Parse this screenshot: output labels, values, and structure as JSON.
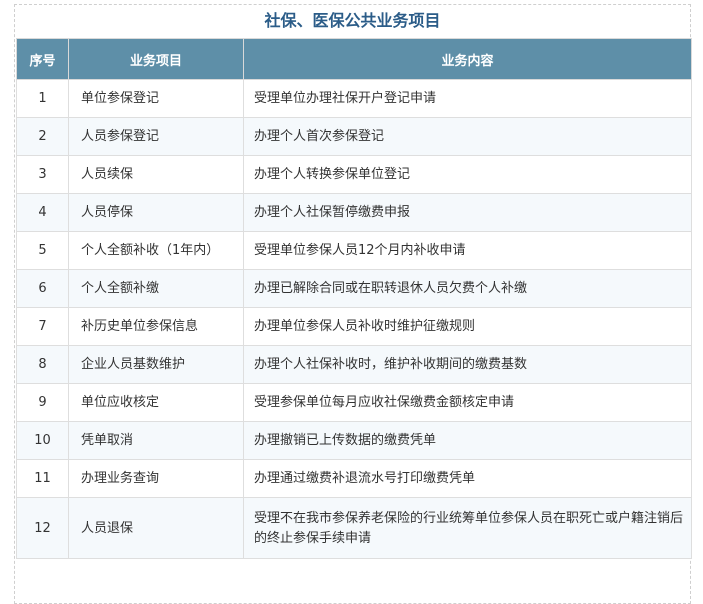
{
  "title": "社保、医保公共业务项目",
  "headers": {
    "no": "序号",
    "item": "业务项目",
    "content": "业务内容"
  },
  "rows": [
    {
      "no": "1",
      "item": "单位参保登记",
      "content": "受理单位办理社保开户登记申请"
    },
    {
      "no": "2",
      "item": "人员参保登记",
      "content": "办理个人首次参保登记"
    },
    {
      "no": "3",
      "item": "人员续保",
      "content": "办理个人转换参保单位登记"
    },
    {
      "no": "4",
      "item": "人员停保",
      "content": "办理个人社保暂停缴费申报"
    },
    {
      "no": "5",
      "item": "个人全额补收（1年内）",
      "content": "受理单位参保人员12个月内补收申请"
    },
    {
      "no": "6",
      "item": "个人全额补缴",
      "content": "办理已解除合同或在职转退休人员欠费个人补缴"
    },
    {
      "no": "7",
      "item": "补历史单位参保信息",
      "content": "办理单位参保人员补收时维护征缴规则"
    },
    {
      "no": "8",
      "item": "企业人员基数维护",
      "content": "办理个人社保补收时，维护补收期间的缴费基数"
    },
    {
      "no": "9",
      "item": "单位应收核定",
      "content": "受理参保单位每月应收社保缴费金额核定申请"
    },
    {
      "no": "10",
      "item": "凭单取消",
      "content": "办理撤销已上传数据的缴费凭单"
    },
    {
      "no": "11",
      "item": "办理业务查询",
      "content": "办理通过缴费补退流水号打印缴费凭单"
    },
    {
      "no": "12",
      "item": "人员退保",
      "content": "受理不在我市参保养老保险的行业统筹单位参保人员在职死亡或户籍注销后的终止参保手续申请"
    }
  ],
  "colors": {
    "title": "#2b5c88",
    "header_bg": "#5e8fa8",
    "header_text": "#ffffff",
    "row_alt": "#f5f9fc"
  }
}
